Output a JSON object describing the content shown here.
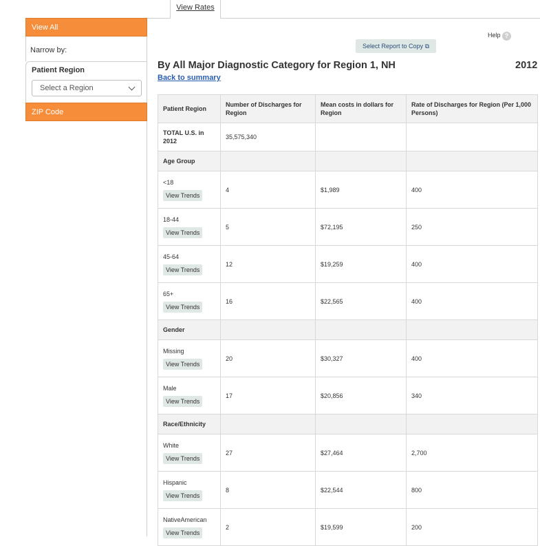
{
  "tabs": {
    "view_rates": "View Rates"
  },
  "sidebar": {
    "view_all": "View All",
    "narrow_by": "Narrow by:",
    "patient_region_title": "Patient Region",
    "region_select_value": "Select a Region",
    "zip_code": "ZIP Code",
    "accent_color": "#f68d3a"
  },
  "toolbar": {
    "help_label": "Help",
    "help_icon": "?",
    "copy_label": "Select Report to Copy",
    "copy_icon": "copy-icon"
  },
  "report": {
    "title": "By All Major Diagnostic Category for Region 1, NH",
    "year": "2012",
    "back_link": "Back to summary"
  },
  "table": {
    "headers": [
      "Patient Region",
      "Number of Discharges for Region",
      "Mean costs in dollars for Region",
      "Rate of Discharges for Region (Per 1,000 Persons)"
    ],
    "total": {
      "label": "TOTAL U.S. in 2012",
      "discharges": "35,575,340",
      "mean_cost": "",
      "rate": ""
    },
    "view_trends_label": "View Trends",
    "groups": [
      {
        "name": "Age Group",
        "rows": [
          {
            "label": "<18",
            "discharges": "4",
            "mean_cost": "$1,989",
            "rate": "400"
          },
          {
            "label": "18-44",
            "discharges": "5",
            "mean_cost": "$72,195",
            "rate": "250"
          },
          {
            "label": "45-64",
            "discharges": "12",
            "mean_cost": "$19,259",
            "rate": "400"
          },
          {
            "label": "65+",
            "discharges": "16",
            "mean_cost": "$22,565",
            "rate": "400"
          }
        ]
      },
      {
        "name": "Gender",
        "rows": [
          {
            "label": "Missing",
            "discharges": "20",
            "mean_cost": "$30,327",
            "rate": "400"
          },
          {
            "label": "Male",
            "discharges": "17",
            "mean_cost": "$20,856",
            "rate": "340"
          }
        ]
      },
      {
        "name": "Race/Ethnicity",
        "rows": [
          {
            "label": "White",
            "discharges": "27",
            "mean_cost": "$27,464",
            "rate": "2,700"
          },
          {
            "label": "Hispanic",
            "discharges": "8",
            "mean_cost": "$22,544",
            "rate": "800"
          },
          {
            "label": "NativeAmerican",
            "discharges": "2",
            "mean_cost": "$19,599",
            "rate": "200"
          }
        ]
      }
    ]
  }
}
